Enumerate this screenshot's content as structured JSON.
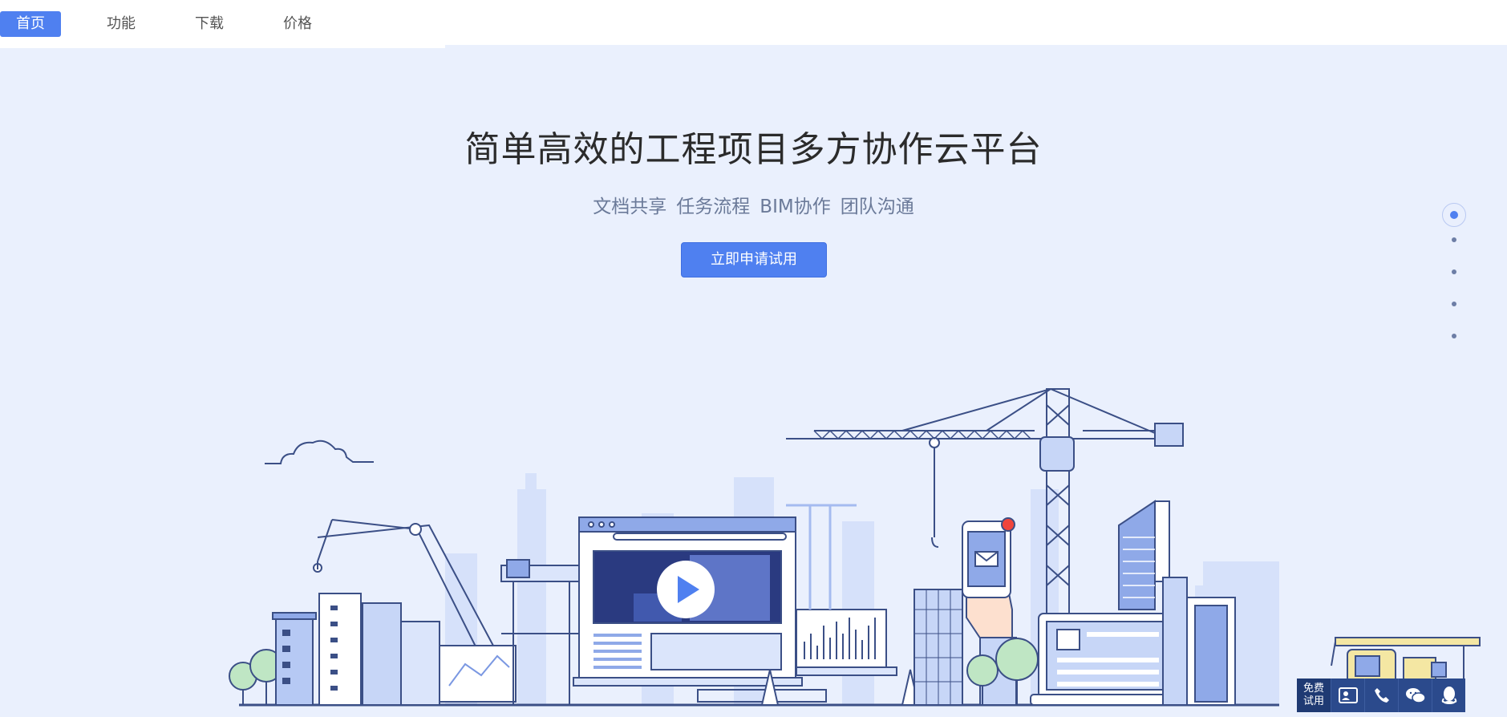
{
  "nav": {
    "items": [
      {
        "label": "首页",
        "active": true
      },
      {
        "label": "功能",
        "active": false
      },
      {
        "label": "下载",
        "active": false
      },
      {
        "label": "价格",
        "active": false
      }
    ]
  },
  "hero": {
    "title": "简单高效的工程项目多方协作云平台",
    "features": [
      "文档共享",
      "任务流程",
      "BIM协作",
      "团队沟通"
    ],
    "cta_label": "立即申请试用"
  },
  "pager": {
    "count": 5,
    "active_index": 0
  },
  "float_bar": {
    "free_trial_line1": "免费",
    "free_trial_line2": "试用",
    "icons": [
      "contact-card-icon",
      "phone-icon",
      "wechat-icon",
      "qq-icon"
    ]
  },
  "colors": {
    "accent": "#4f80f0",
    "background": "#eaf0fd",
    "illustration_stroke": "#3b4f86",
    "illustration_fill": "#c7d6f7"
  }
}
